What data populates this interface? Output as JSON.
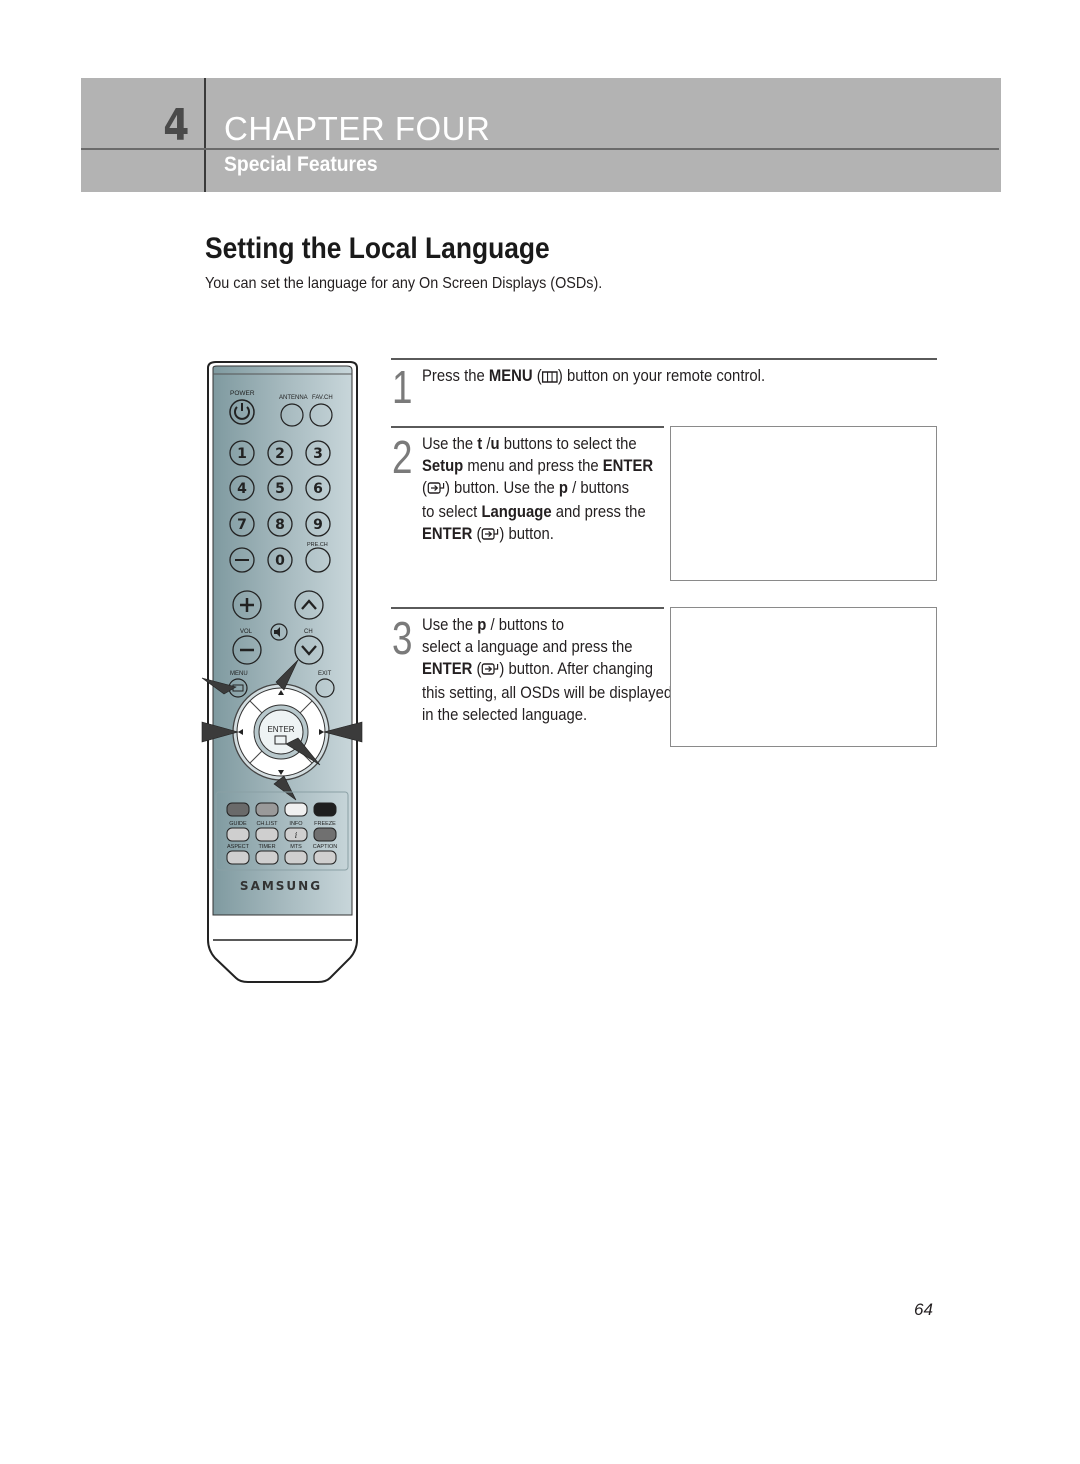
{
  "header": {
    "chapter_number": "4",
    "chapter_title": "CHAPTER FOUR",
    "section_title": "Special Features",
    "band_color": "#b3b3b3"
  },
  "page": {
    "title": "Setting the Local Language",
    "intro": "You can set the language for any On Screen Displays (OSDs).",
    "page_number": "64"
  },
  "steps": [
    {
      "number": "1",
      "lines": [
        [
          {
            "t": "Press the "
          },
          {
            "t": "MENU",
            "b": true
          },
          {
            "t": " ("
          },
          {
            "icon": "menu-icon"
          },
          {
            "t": ") button on your remote control."
          }
        ]
      ]
    },
    {
      "number": "2",
      "lines": [
        [
          {
            "t": "Use the "
          },
          {
            "t": "t",
            "b": true
          },
          {
            "t": "  /"
          },
          {
            "t": "u",
            "b": true
          },
          {
            "t": "  buttons to select the"
          }
        ],
        [
          {
            "t": "Setup",
            "b": true
          },
          {
            "t": " menu and press the "
          },
          {
            "t": "ENTER",
            "b": true
          }
        ],
        [
          {
            "t": "("
          },
          {
            "icon": "enter-icon"
          },
          {
            "t": ") button. Use the "
          },
          {
            "t": "p",
            "b": true
          },
          {
            "t": "  /      buttons"
          }
        ],
        [
          {
            "t": "to select "
          },
          {
            "t": "Language",
            "b": true
          },
          {
            "t": " and press the"
          }
        ],
        [
          {
            "t": "ENTER",
            "b": true
          },
          {
            "t": " ("
          },
          {
            "icon": "enter-icon"
          },
          {
            "t": ") button."
          }
        ]
      ]
    },
    {
      "number": "3",
      "lines": [
        [
          {
            "t": "Use the "
          },
          {
            "t": "p",
            "b": true
          },
          {
            "t": "  /      buttons to"
          }
        ],
        [
          {
            "t": "select a language and press the"
          }
        ],
        [
          {
            "t": "ENTER",
            "b": true
          },
          {
            "t": " ("
          },
          {
            "icon": "enter-icon"
          },
          {
            "t": ") button. After changing"
          }
        ],
        [
          {
            "t": "this setting, all OSDs will be displayed"
          }
        ],
        [
          {
            "t": "in the selected language."
          }
        ]
      ]
    }
  ],
  "remote": {
    "brand": "SAMSUNG",
    "labels": {
      "power": "POWER",
      "antenna": "ANTENNA",
      "favch": "FAV.CH",
      "prech": "PRE.CH",
      "vol": "VOL",
      "ch": "CH",
      "menu": "MENU",
      "exit": "EXIT",
      "enter": "ENTER",
      "guide": "GUIDE",
      "chlist": "CH.LIST",
      "info": "INFO",
      "freeze": "FREEZE",
      "aspect": "ASPECT",
      "timer": "TIMER",
      "mts": "MTS",
      "caption": "CAPTION"
    },
    "digits": [
      "1",
      "2",
      "3",
      "4",
      "5",
      "6",
      "7",
      "8",
      "9",
      "–",
      "0"
    ]
  }
}
